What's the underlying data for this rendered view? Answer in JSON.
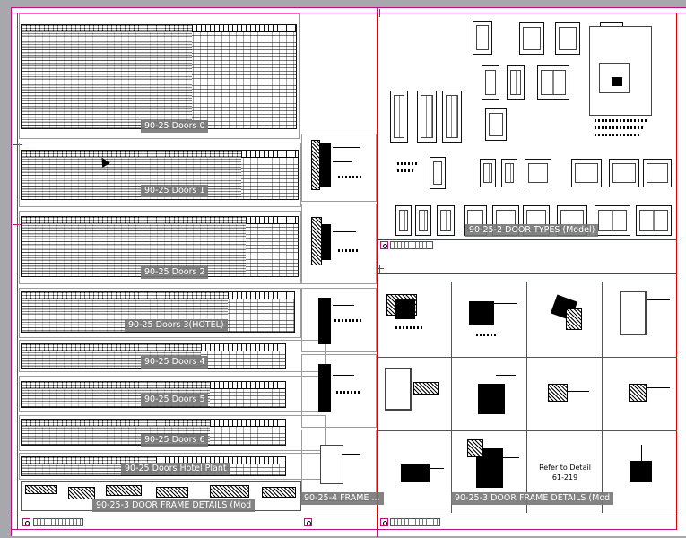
{
  "sheet": {
    "colors": {
      "sheet_border": "#c0107f",
      "viewport_border": "#e00000",
      "label_bg": "#767676",
      "label_text": "#ffffff"
    }
  },
  "viewports": {
    "doors_0": "90-25 Doors 0",
    "doors_1": "90-25 Doors 1",
    "doors_2": "90-25 Doors 2",
    "doors_3": "90-25 Doors 3(HOTEL)",
    "doors_4": "90-25 Doors 4",
    "doors_5": "90-25 Doors 5",
    "doors_6": "90-25 Doors 6",
    "doors_hotel_plant": "90-25 Doors Hotel Plant",
    "frame_details_left": "90-25-3 DOOR FRAME DETAILS (Mod",
    "frame_details_4": "90-25-4 FRAME ...",
    "door_types": "90-25-2 DOOR TYPES (Model)",
    "frame_details_right": "90-25-3 DOOR FRAME DETAILS (Mod"
  },
  "detail_note": {
    "line1": "Refer to Detail",
    "line2": "61-219"
  }
}
